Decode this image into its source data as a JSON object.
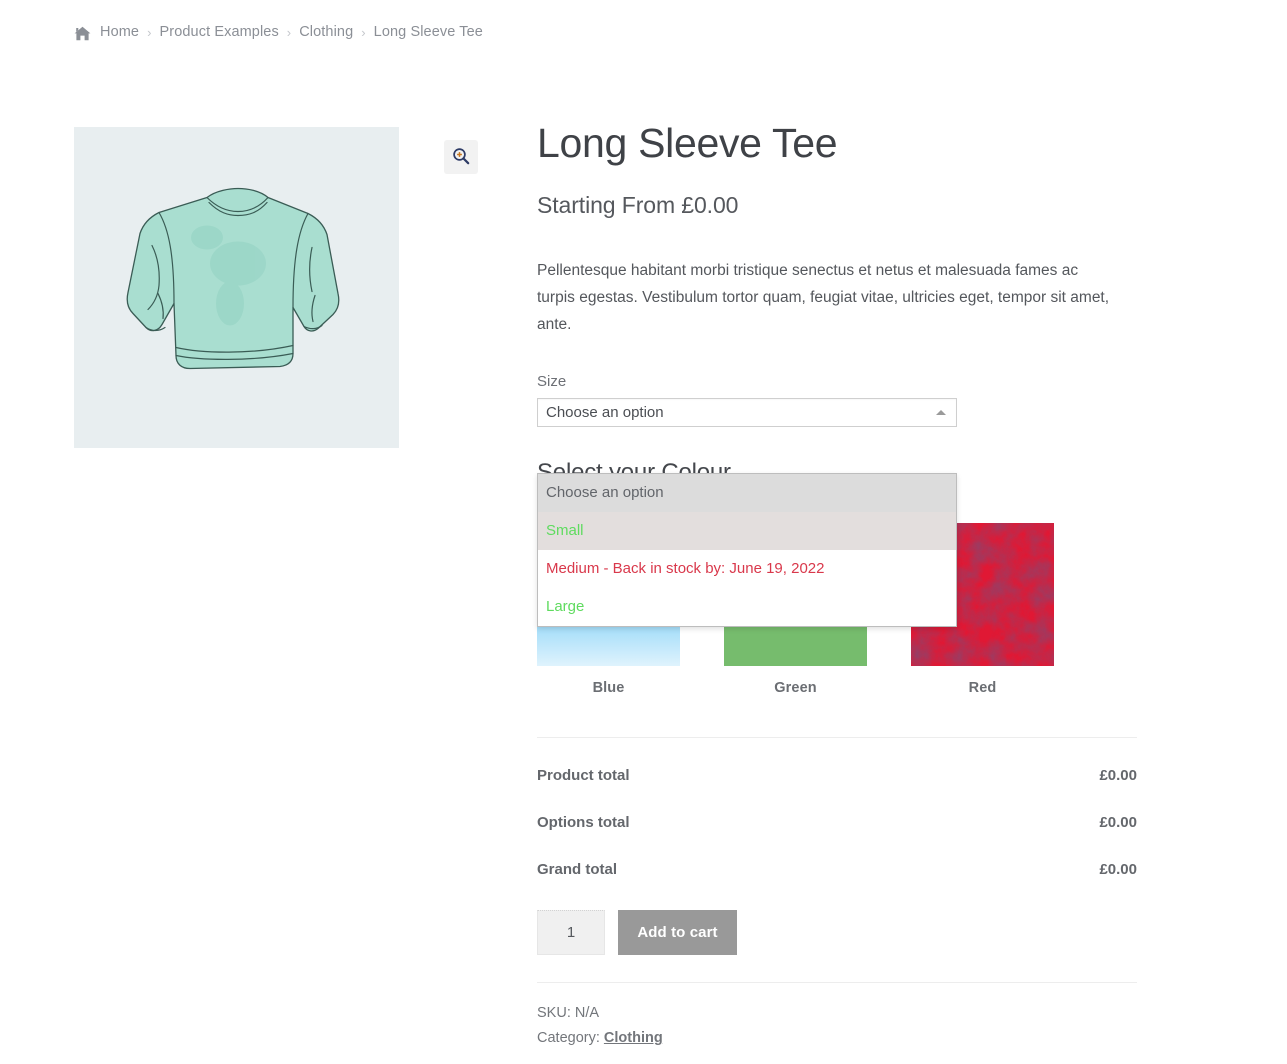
{
  "breadcrumb": {
    "home_icon": "home-icon",
    "separator": "›",
    "items": [
      {
        "label": "Home",
        "link": true
      },
      {
        "label": "Product Examples",
        "link": true
      },
      {
        "label": "Clothing",
        "link": true
      },
      {
        "label": "Long Sleeve Tee",
        "link": false
      }
    ]
  },
  "gallery": {
    "zoom_icon": "magnifier-plus-icon",
    "image_alt": "Mint green long sleeve tee illustration",
    "background_color": "#e8eef0",
    "shirt_color": "#a9ded0"
  },
  "product": {
    "title": "Long Sleeve Tee",
    "price": "Starting From £0.00",
    "description": "Pellentesque habitant morbi tristique senectus et netus et malesuada fames ac turpis egestas. Vestibulum tortor quam, feugiat vitae, ultricies eget, tempor sit amet, ante."
  },
  "size_field": {
    "label": "Size",
    "selected": "Choose an option",
    "caret_icon": "caret-up-icon",
    "open": true,
    "options": [
      {
        "label": "Choose an option",
        "state": "placeholder",
        "color": "#62656a"
      },
      {
        "label": "Small",
        "state": "in-stock",
        "color": "#5fdb5f"
      },
      {
        "label": "Medium - Back in stock by: June 19, 2022",
        "state": "backorder",
        "color": "#d9384b"
      },
      {
        "label": "Large",
        "state": "in-stock",
        "color": "#5fdb5f"
      }
    ]
  },
  "colour_field": {
    "heading": "Select your Colour",
    "swatches": [
      {
        "label": "Blue",
        "type": "gradient",
        "color": "#4fbdf2"
      },
      {
        "label": "Green",
        "type": "texture",
        "color": "#4a9c43"
      },
      {
        "label": "Red",
        "type": "texture",
        "color": "#e01834"
      }
    ]
  },
  "totals": [
    {
      "label": "Product total",
      "value": "£0.00"
    },
    {
      "label": "Options total",
      "value": "£0.00"
    },
    {
      "label": "Grand total",
      "value": "£0.00"
    }
  ],
  "cart": {
    "quantity": "1",
    "add_to_cart_label": "Add to cart",
    "button_color": "#999999"
  },
  "meta": {
    "sku_label": "SKU:",
    "sku_value": "N/A",
    "category_label": "Category:",
    "category_value": "Clothing"
  }
}
